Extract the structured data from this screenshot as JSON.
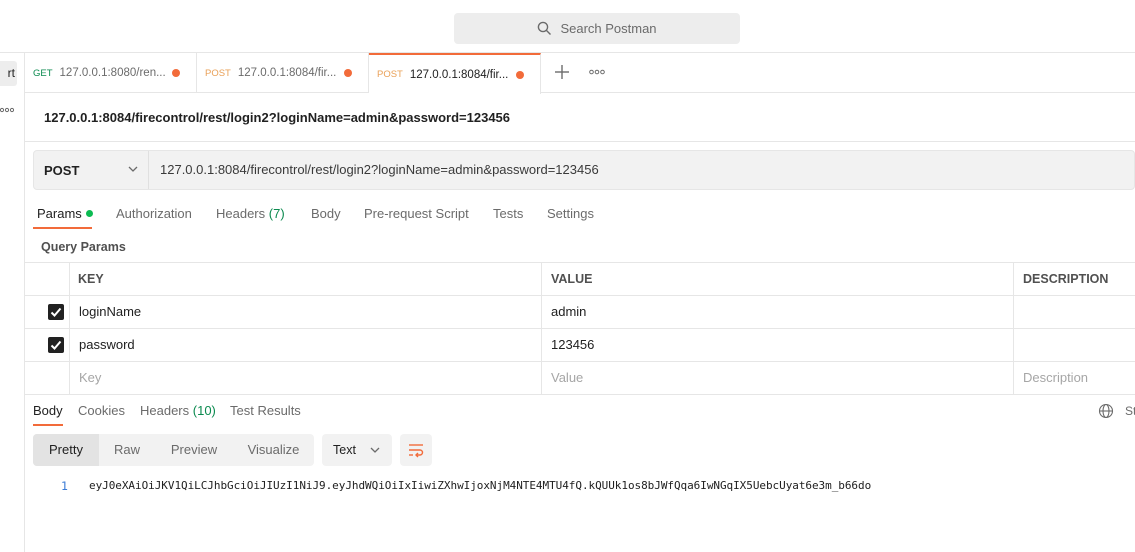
{
  "search": {
    "placeholder": "Search Postman"
  },
  "left_rail": {
    "button_label": "rt"
  },
  "tabs": [
    {
      "method": "GET",
      "label": "127.0.0.1:8080/ren..."
    },
    {
      "method": "POST",
      "label": "127.0.0.1:8084/fir..."
    },
    {
      "method": "POST",
      "label": "127.0.0.1:8084/fir..."
    }
  ],
  "request": {
    "title": "127.0.0.1:8084/firecontrol/rest/login2?loginName=admin&password=123456",
    "method": "POST",
    "url": "127.0.0.1:8084/firecontrol/rest/login2?loginName=admin&password=123456"
  },
  "request_tabs": {
    "params": "Params",
    "authorization": "Authorization",
    "headers": "Headers",
    "headers_count": "(7)",
    "body": "Body",
    "prerequest": "Pre-request Script",
    "tests": "Tests",
    "settings": "Settings"
  },
  "query_params": {
    "title": "Query Params",
    "columns": {
      "key": "KEY",
      "value": "VALUE",
      "description": "DESCRIPTION"
    },
    "rows": [
      {
        "key": "loginName",
        "value": "admin",
        "checked": true
      },
      {
        "key": "password",
        "value": "123456",
        "checked": true
      }
    ],
    "placeholders": {
      "key": "Key",
      "value": "Value",
      "description": "Description"
    }
  },
  "response_tabs": {
    "body": "Body",
    "cookies": "Cookies",
    "headers": "Headers",
    "headers_count": "(10)",
    "test_results": "Test Results",
    "status_truncated": "St"
  },
  "view_modes": {
    "pretty": "Pretty",
    "raw": "Raw",
    "preview": "Preview",
    "visualize": "Visualize"
  },
  "format": "Text",
  "response_body": {
    "line_number": "1",
    "text": "eyJ0eXAiOiJKV1QiLCJhbGciOiJIUzI1NiJ9.eyJhdWQiOiIxIiwiZXhwIjoxNjM4NTE4MTU4fQ.kQUUk1os8bJWfQqa6IwNGqIX5UebcUyat6e3m_b66do"
  },
  "colors": {
    "accent": "#f26b3a",
    "get": "#0b8a4f",
    "post": "#e9a057",
    "params_dot": "#0cbb52"
  }
}
